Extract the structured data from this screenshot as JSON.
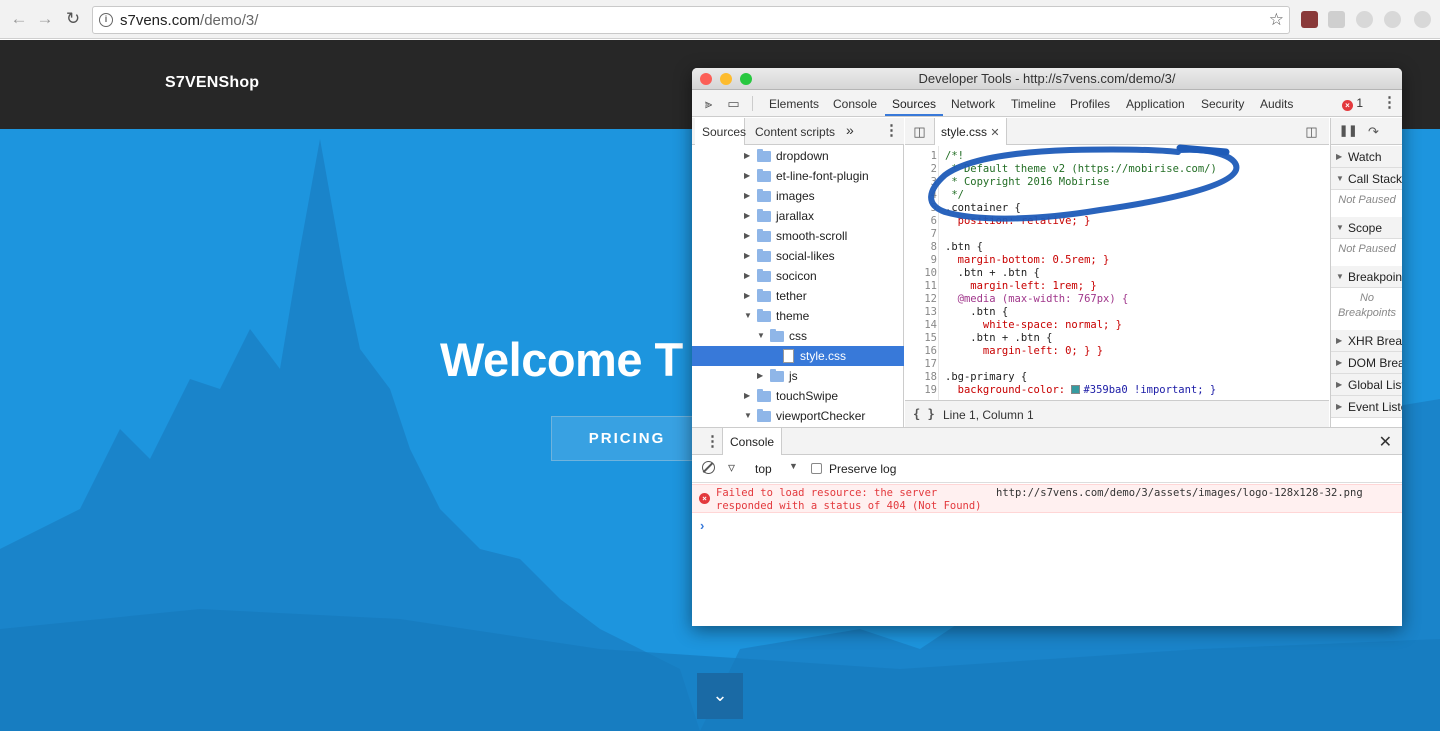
{
  "browser": {
    "back_icon": "arrow-left-icon",
    "forward_icon": "arrow-right-icon",
    "reload_icon": "reload-icon",
    "url_host": "s7vens.com",
    "url_path": "/demo/3/",
    "bookmark_icon": "star-icon"
  },
  "site": {
    "logo": "S7VENShop",
    "hero_title": "Welcome T",
    "pricing_button": "PRICING",
    "scroll_down_icon": "chevron-down-icon",
    "hero_color": "#1d95de"
  },
  "devtools": {
    "title": "Developer Tools - http://s7vens.com/demo/3/",
    "tabs": [
      "Elements",
      "Console",
      "Sources",
      "Network",
      "Timeline",
      "Profiles",
      "Application",
      "Security",
      "Audits"
    ],
    "active_tab": "Sources",
    "error_count": "1",
    "navigator": {
      "tabs": [
        "Sources",
        "Content scripts"
      ],
      "more": "»",
      "tree": [
        {
          "label": "dropdown",
          "type": "folder",
          "expanded": false,
          "depth": 0
        },
        {
          "label": "et-line-font-plugin",
          "type": "folder",
          "expanded": false,
          "depth": 0
        },
        {
          "label": "images",
          "type": "folder",
          "expanded": false,
          "depth": 0
        },
        {
          "label": "jarallax",
          "type": "folder",
          "expanded": false,
          "depth": 0
        },
        {
          "label": "smooth-scroll",
          "type": "folder",
          "expanded": false,
          "depth": 0
        },
        {
          "label": "social-likes",
          "type": "folder",
          "expanded": false,
          "depth": 0
        },
        {
          "label": "socicon",
          "type": "folder",
          "expanded": false,
          "depth": 0
        },
        {
          "label": "tether",
          "type": "folder",
          "expanded": false,
          "depth": 0
        },
        {
          "label": "theme",
          "type": "folder",
          "expanded": true,
          "depth": 0
        },
        {
          "label": "css",
          "type": "folder",
          "expanded": true,
          "depth": 1
        },
        {
          "label": "style.css",
          "type": "file",
          "selected": true,
          "depth": 2
        },
        {
          "label": "js",
          "type": "folder",
          "expanded": false,
          "depth": 1
        },
        {
          "label": "touchSwipe",
          "type": "folder",
          "expanded": false,
          "depth": 0
        },
        {
          "label": "viewportChecker",
          "type": "folder",
          "expanded": true,
          "depth": 0
        }
      ]
    },
    "editor": {
      "file_tab": "style.css",
      "status": "Line 1, Column 1",
      "format_icon": "{ }",
      "lines": [
        {
          "n": "1",
          "t": "/*!",
          "c": "com"
        },
        {
          "n": "2",
          "t": " * Default theme v2 (https://mobirise.com/)",
          "c": "com"
        },
        {
          "n": "3",
          "t": " * Copyright 2016 Mobirise",
          "c": "com"
        },
        {
          "n": "4",
          "t": " */",
          "c": "com"
        },
        {
          "n": "5",
          "t": ".container {",
          "c": "sel"
        },
        {
          "n": "6",
          "t": "  position: relative; }",
          "c": "prop"
        },
        {
          "n": "7",
          "t": "",
          "c": "sel"
        },
        {
          "n": "8",
          "t": ".btn {",
          "c": "sel"
        },
        {
          "n": "9",
          "t": "  margin-bottom: 0.5rem; }",
          "c": "prop"
        },
        {
          "n": "10",
          "t": "  .btn + .btn {",
          "c": "sel"
        },
        {
          "n": "11",
          "t": "    margin-left: 1rem; }",
          "c": "prop"
        },
        {
          "n": "12",
          "t": "  @media (max-width: 767px) {",
          "c": "at"
        },
        {
          "n": "13",
          "t": "    .btn {",
          "c": "sel"
        },
        {
          "n": "14",
          "t": "      white-space: normal; }",
          "c": "prop"
        },
        {
          "n": "15",
          "t": "    .btn + .btn {",
          "c": "sel"
        },
        {
          "n": "16",
          "t": "      margin-left: 0; } }",
          "c": "prop"
        },
        {
          "n": "17",
          "t": "",
          "c": "sel"
        },
        {
          "n": "18",
          "t": ".bg-primary {",
          "c": "sel"
        },
        {
          "n": "19",
          "t": "  background-color: #359ba0 !important; }",
          "c": "prop"
        }
      ]
    },
    "debugger": {
      "sections": [
        "Watch",
        "Call Stack",
        "Scope",
        "Breakpoints",
        "XHR Breakpoints",
        "DOM Breakpoints",
        "Global Listeners",
        "Event Listener Breakpoints"
      ],
      "not_paused": "Not Paused",
      "no_breakpoints": "No Breakpoints"
    },
    "console": {
      "tab": "Console",
      "context": "top",
      "preserve_log": "Preserve log",
      "error_message_line1": "Failed to load resource: the server",
      "error_message_line2": "responded with a status of 404 (Not Found)",
      "error_url": "http://s7vens.com/demo/3/assets/images/logo-128x128-32.png",
      "prompt": "›"
    }
  },
  "annotation_color": "#1e5bb8"
}
